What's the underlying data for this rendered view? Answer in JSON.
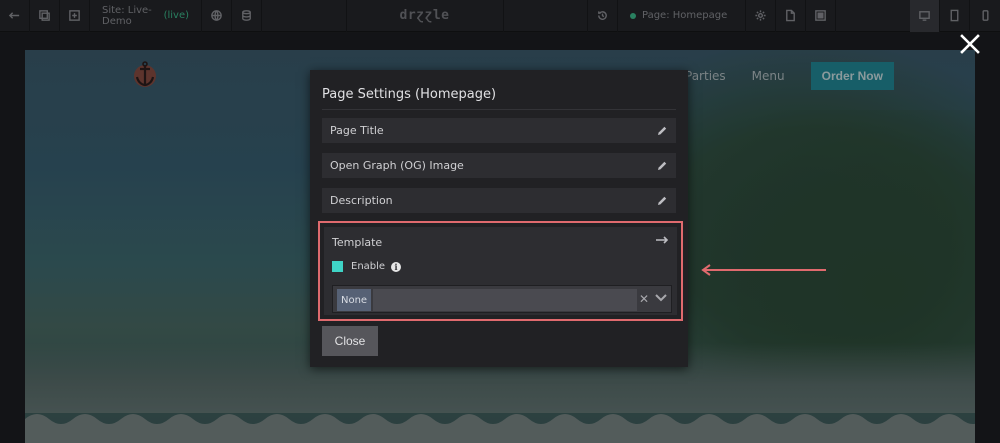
{
  "toolbar": {
    "site_prefix": "Site: Live-Demo",
    "site_status": "(live)",
    "logo": "drɀɀle",
    "page_label": "Page: Homepage",
    "icons": [
      "back-arrow-icon",
      "copy-icon",
      "add-icon",
      "globe-icon",
      "database-icon",
      "history-icon",
      "gear-icon",
      "document-icon",
      "save-icon",
      "desktop-icon",
      "tablet-icon",
      "phone-icon"
    ]
  },
  "site_preview": {
    "nav_items": [
      "Parties",
      "Menu"
    ],
    "order_button": "Order Now"
  },
  "modal": {
    "title": "Page Settings (Homepage)",
    "fields": {
      "page_title": "Page Title",
      "og_image": "Open Graph (OG) Image",
      "description": "Description"
    },
    "template": {
      "label": "Template",
      "enable_label": "Enable",
      "enable_checked": true,
      "selected_value": "None",
      "clear_symbol": "✕"
    },
    "close_label": "Close"
  },
  "colors": {
    "accent_teal": "#3fd4c6",
    "live_green": "#3bbf8c",
    "highlight_red": "#e06a6e",
    "order_button": "#1f8a98"
  }
}
